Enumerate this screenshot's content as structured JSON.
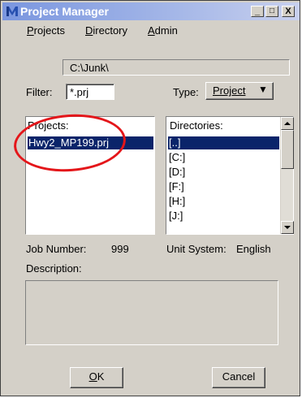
{
  "window": {
    "title": "Project Manager",
    "controls": {
      "minimize": "_",
      "maximize": "□",
      "close": "X"
    }
  },
  "menu": {
    "projects": {
      "mnemonic": "P",
      "rest": "rojects"
    },
    "directory": {
      "mnemonic": "D",
      "rest": "irectory"
    },
    "admin": {
      "mnemonic": "A",
      "rest": "dmin"
    }
  },
  "path": "C:\\Junk\\",
  "filter": {
    "label": "Filter:",
    "value": "*.prj"
  },
  "type": {
    "label": "Type:",
    "value": "Project",
    "arrow": "▼"
  },
  "projects": {
    "label": "Projects:",
    "items": [
      "Hwy2_MP199.prj"
    ],
    "selected_index": 0
  },
  "directories": {
    "label": "Directories:",
    "items": [
      "[..]",
      "[C:]",
      "[D:]",
      "[F:]",
      "[H:]",
      "[J:]"
    ],
    "selected_index": 0
  },
  "job_number": {
    "label": "Job Number:",
    "value": "999"
  },
  "unit_system": {
    "label": "Unit System:",
    "value": "English"
  },
  "description": {
    "label": "Description:",
    "value": ""
  },
  "buttons": {
    "ok": {
      "mnemonic": "O",
      "rest": "K"
    },
    "cancel": "Cancel"
  },
  "colors": {
    "selection": "#0a246a",
    "annotation_circle": "#e4161a",
    "title_gradient_start": "#7a96df"
  }
}
